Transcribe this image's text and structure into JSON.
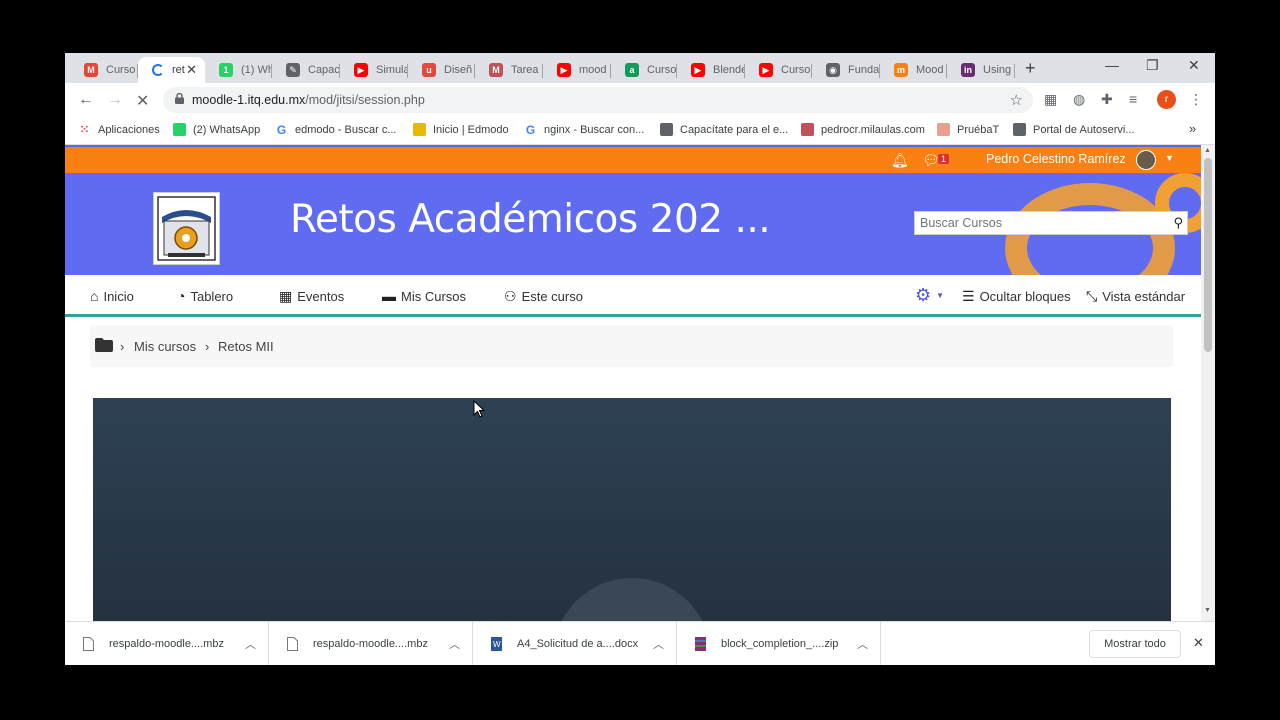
{
  "browser": {
    "tabs": [
      {
        "title": "Curso",
        "fav": "gmail-icon",
        "color": "#ea4335",
        "letter": "M"
      },
      {
        "title": "ret",
        "fav": "loading-icon",
        "color": "#1a73e8",
        "letter": "",
        "active": true
      },
      {
        "title": "(1) Wh",
        "fav": "whatsapp-icon",
        "color": "#25d366",
        "letter": "1"
      },
      {
        "title": "Capac",
        "fav": "edit-icon",
        "color": "#5f6368",
        "letter": "✎"
      },
      {
        "title": "Simula",
        "fav": "youtube-icon",
        "color": "#ff0000",
        "letter": "▶"
      },
      {
        "title": "Diseñ",
        "fav": "pen-icon",
        "color": "#e8453c",
        "letter": "u"
      },
      {
        "title": "Tarea",
        "fav": "milaulas-icon",
        "color": "#c0505a",
        "letter": "M"
      },
      {
        "title": "mood",
        "fav": "youtube-icon",
        "color": "#ff0000",
        "letter": "▶"
      },
      {
        "title": "Curso",
        "fav": "classroom-icon",
        "color": "#0f9d58",
        "letter": "a"
      },
      {
        "title": "Blende",
        "fav": "youtube-icon",
        "color": "#ff0000",
        "letter": "▶"
      },
      {
        "title": "Curso",
        "fav": "youtube-icon",
        "color": "#ff0000",
        "letter": "▶"
      },
      {
        "title": "Funda",
        "fav": "globe-icon",
        "color": "#5f6368",
        "letter": "◉"
      },
      {
        "title": "Mood",
        "fav": "moodle-icon",
        "color": "#f98012",
        "letter": "m"
      },
      {
        "title": "Using",
        "fav": "invision-icon",
        "color": "#6a2c70",
        "letter": "in"
      }
    ],
    "url_host": "moodle-1.itq.edu.mx",
    "url_path": "/mod/jitsi/session.php",
    "profile_letter": "r",
    "bookmarks": [
      {
        "label": "Aplicaciones",
        "fav": "apps-icon",
        "color": "#4285f4"
      },
      {
        "label": "(2) WhatsApp",
        "fav": "whatsapp-icon",
        "color": "#25d366"
      },
      {
        "label": "edmodo - Buscar c...",
        "fav": "google-icon",
        "color": "#4285f4"
      },
      {
        "label": "Inicio | Edmodo",
        "fav": "edmodo-icon",
        "color": "#e6b800"
      },
      {
        "label": "nginx - Buscar con...",
        "fav": "google-icon",
        "color": "#4285f4"
      },
      {
        "label": "Capacítate para el e...",
        "fav": "edit-icon",
        "color": "#5f6368"
      },
      {
        "label": "pedrocr.milaulas.com",
        "fav": "milaulas-icon",
        "color": "#c0505a"
      },
      {
        "label": "PruébaT",
        "fav": "pruebat-icon",
        "color": "#e8a090"
      },
      {
        "label": "Portal de Autoservi...",
        "fav": "globe-icon",
        "color": "#5f6368"
      }
    ],
    "bookmarks_more": "»"
  },
  "moodle": {
    "notifications_badge": "1",
    "user_name": "Pedro Celestino Ramírez",
    "site_title": "Retos Académicos 202 ...",
    "search_placeholder": "Buscar Cursos",
    "nav_items": [
      {
        "label": "Inicio",
        "icon": "home-icon",
        "glyph": "⌂"
      },
      {
        "label": "Tablero",
        "icon": "dashboard-icon",
        "glyph": "◔"
      },
      {
        "label": "Eventos",
        "icon": "calendar-icon",
        "glyph": "▦"
      },
      {
        "label": "Mis Cursos",
        "icon": "briefcase-icon",
        "glyph": "▬"
      },
      {
        "label": "Este curso",
        "icon": "sitemap-icon",
        "glyph": "⚇"
      }
    ],
    "hide_blocks": "Ocultar bloques",
    "standard_view": "Vista estándar",
    "breadcrumb": [
      "Mis cursos",
      "Retos MII"
    ]
  },
  "downloads": [
    {
      "name": "respaldo-moodle....mbz",
      "icon": "file-icon"
    },
    {
      "name": "respaldo-moodle....mbz",
      "icon": "file-icon"
    },
    {
      "name": "A4_Solicitud de a....docx",
      "icon": "word-doc-icon"
    },
    {
      "name": "block_completion_....zip",
      "icon": "zip-archive-icon"
    }
  ],
  "show_all": "Mostrar todo",
  "colors": {
    "moodle_orange": "#f98012",
    "banner_blue": "#5f6bf0",
    "nav_accent": "#2fa59a"
  }
}
